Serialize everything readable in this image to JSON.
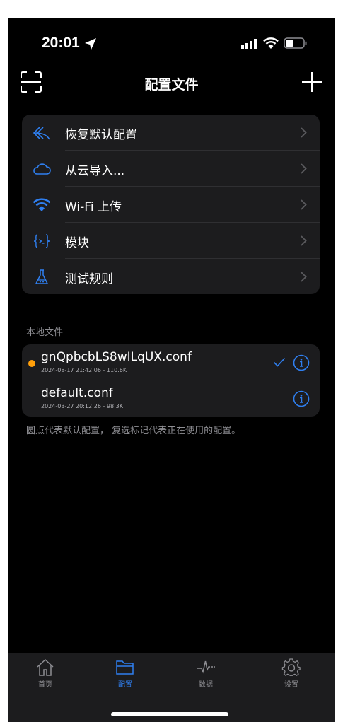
{
  "status_bar": {
    "time": "20:01"
  },
  "nav": {
    "title": "配置文件"
  },
  "menu": [
    {
      "label": "恢复默认配置",
      "icon": "undo-arrow-icon"
    },
    {
      "label": "从云导入...",
      "icon": "cloud-icon"
    },
    {
      "label": "Wi-Fi 上传",
      "icon": "wifi-icon"
    },
    {
      "label": "模块",
      "icon": "module-braces-icon"
    },
    {
      "label": "测试规则",
      "icon": "flask-icon"
    }
  ],
  "local_files": {
    "header": "本地文件",
    "files": [
      {
        "name": "gnQpbcbLS8wILqUX.conf",
        "meta": "2024-08-17 21:42:06 - 110.6K",
        "is_default": true,
        "in_use": true
      },
      {
        "name": "default.conf",
        "meta": "2024-03-27 20:12:26 - 98.3K",
        "is_default": false,
        "in_use": false
      }
    ],
    "footnote": "圆点代表默认配置， 复选标记代表正在使用的配置。"
  },
  "tabs": [
    {
      "label": "首页",
      "icon": "home-icon",
      "active": false
    },
    {
      "label": "配置",
      "icon": "folder-icon",
      "active": true
    },
    {
      "label": "数据",
      "icon": "pulse-icon",
      "active": false
    },
    {
      "label": "设置",
      "icon": "gear-icon",
      "active": false
    }
  ],
  "colors": {
    "accent": "#2f7ff0",
    "default_dot": "#ff9f0a",
    "card_bg": "#1c1c1e"
  }
}
